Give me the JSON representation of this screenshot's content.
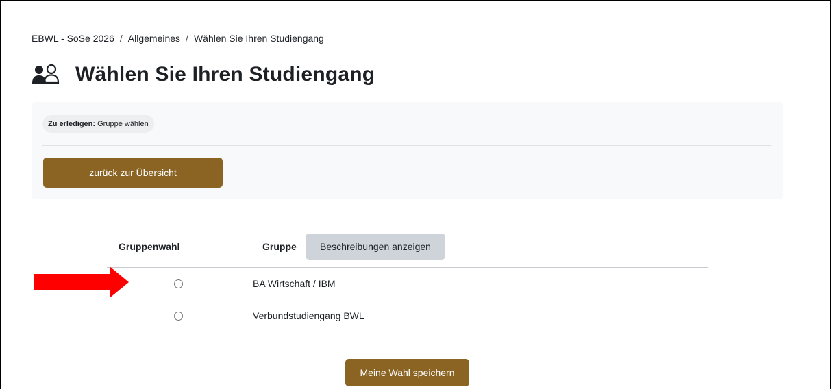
{
  "breadcrumb": {
    "items": [
      "EBWL - SoSe 2026",
      "Allgemeines",
      "Wählen Sie Ihren Studiengang"
    ],
    "separator": "/"
  },
  "page": {
    "title": "Wählen Sie Ihren Studiengang",
    "icon": "users-icon"
  },
  "activity": {
    "todo_label": "Zu erledigen:",
    "todo_value": "Gruppe wählen",
    "back_button": "zurück zur Übersicht"
  },
  "table": {
    "col_choice": "Gruppenwahl",
    "col_group": "Gruppe",
    "descriptions_button": "Beschreibungen anzeigen",
    "rows": [
      {
        "label": "BA Wirtschaft / IBM",
        "selected": false
      },
      {
        "label": "Verbundstudiengang BWL",
        "selected": false
      }
    ]
  },
  "annotation": {
    "arrow_color": "#ff0000",
    "icon": "red-arrow"
  },
  "save_button": "Meine Wahl speichern",
  "colors": {
    "accent": "#8b6424",
    "secondary_button": "#ced4da",
    "panel_bg": "#f8f9fa"
  }
}
